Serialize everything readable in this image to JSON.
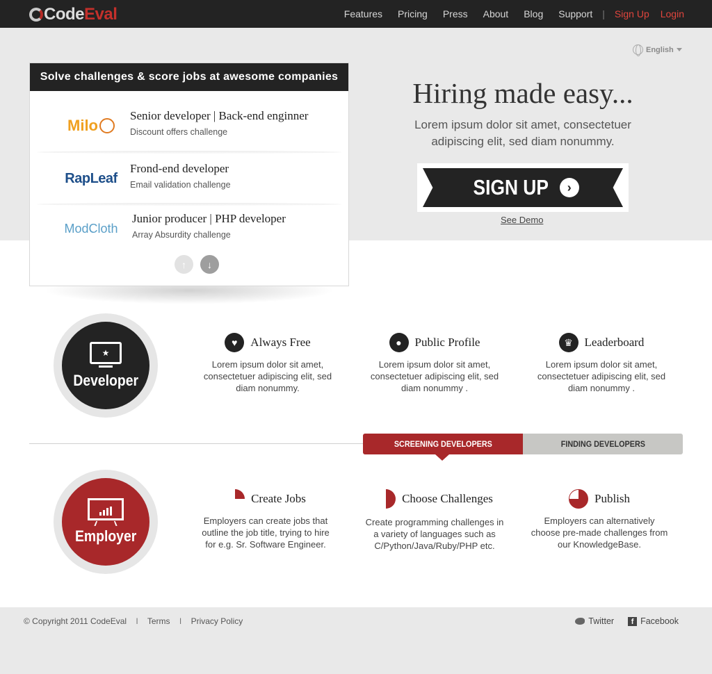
{
  "brand": {
    "name_a": "Code",
    "name_b": "Eval"
  },
  "nav": {
    "items": [
      "Features",
      "Pricing",
      "Press",
      "About",
      "Blog",
      "Support"
    ],
    "separator": "|",
    "signup": "Sign Up",
    "login": "Login"
  },
  "language": {
    "selected": "English"
  },
  "hero": {
    "title": "Hiring made easy...",
    "subtitle": "Lorem ipsum dolor sit amet, consectetuer adipiscing elit, sed diam nonummy.",
    "signup_label": "SIGN UP",
    "demo_link": "See Demo"
  },
  "jobs_card": {
    "heading": "Solve challenges & score jobs at awesome companies",
    "jobs": [
      {
        "company": "Milo",
        "title": "Senior developer | Back-end enginner",
        "challenge": "Discount offers challenge"
      },
      {
        "company": "RapLeaf",
        "title": "Frond-end developer",
        "challenge": "Email validation challenge"
      },
      {
        "company": "ModCloth",
        "title": "Junior producer | PHP developer",
        "challenge": "Array Absurdity challenge"
      }
    ]
  },
  "developer": {
    "label": "Developer",
    "features": [
      {
        "icon": "heart-icon",
        "title": "Always Free",
        "text": "Lorem ipsum dolor sit amet, consectetuer adipiscing elit, sed diam nonummy."
      },
      {
        "icon": "users-icon",
        "title": "Public Profile",
        "text": "Lorem ipsum dolor sit amet, consectetuer adipiscing elit, sed diam nonummy ."
      },
      {
        "icon": "crown-icon",
        "title": "Leaderboard",
        "text": "Lorem ipsum dolor sit amet, consectetuer adipiscing elit, sed diam nonummy ."
      }
    ]
  },
  "tabs": {
    "active": "SCREENING DEVELOPERS",
    "inactive": "FINDING DEVELOPERS"
  },
  "employer": {
    "label": "Employer",
    "steps": [
      {
        "title": "Create Jobs",
        "text": "Employers can create jobs that outline the job title, trying to hire for e.g. Sr. Software Engineer."
      },
      {
        "title": "Choose Challenges",
        "text": "Create programming challenges in a variety of languages such as C/Python/Java/Ruby/PHP etc."
      },
      {
        "title": "Publish",
        "text": "Employers can alternatively choose pre-made challenges from our KnowledgeBase."
      }
    ]
  },
  "footer": {
    "copyright": "© Copyright 2011 CodeEval",
    "sep": "I",
    "terms": "Terms",
    "privacy": "Privacy Policy",
    "twitter": "Twitter",
    "facebook": "Facebook"
  },
  "colors": {
    "accent_red": "#a8282a",
    "nav_red": "#e0453d",
    "dark": "#232323"
  }
}
